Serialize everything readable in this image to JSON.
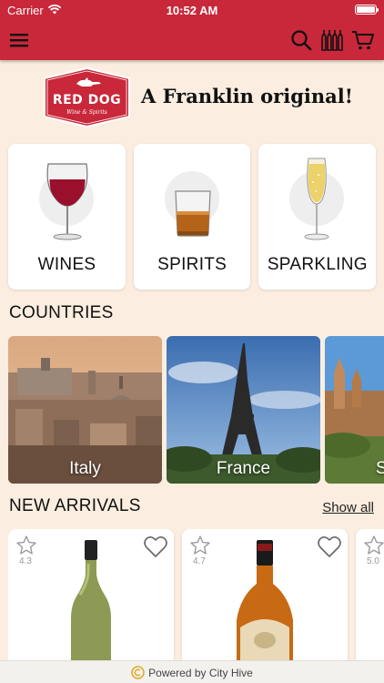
{
  "status_bar": {
    "carrier": "Carrier",
    "time": "10:52 AM"
  },
  "navbar": {
    "icons": [
      "menu-icon",
      "search-icon",
      "wine-bottles-icon",
      "cart-icon"
    ],
    "accent_color": "#c8283a"
  },
  "brand": {
    "logo_text": "RED DOG",
    "logo_subtext": "Wine & Spirits",
    "tagline": "A Franklin original!"
  },
  "categories": [
    {
      "label": "WINES",
      "icon": "red-wine-glass-icon"
    },
    {
      "label": "SPIRITS",
      "icon": "whiskey-glass-icon"
    },
    {
      "label": "SPARKLING",
      "icon": "champagne-flute-icon"
    }
  ],
  "countries": {
    "title": "COUNTRIES",
    "items": [
      {
        "name": "Italy"
      },
      {
        "name": "France"
      },
      {
        "name": "S"
      }
    ]
  },
  "new_arrivals": {
    "title": "NEW ARRIVALS",
    "show_all": "Show all",
    "items": [
      {
        "rating": "4.3",
        "bottle": "green-wine-bottle"
      },
      {
        "rating": "4.7",
        "bottle": "bourbon-bottle"
      },
      {
        "rating": "5.0",
        "bottle": ""
      }
    ]
  },
  "footer": {
    "text": "Powered by City Hive"
  }
}
